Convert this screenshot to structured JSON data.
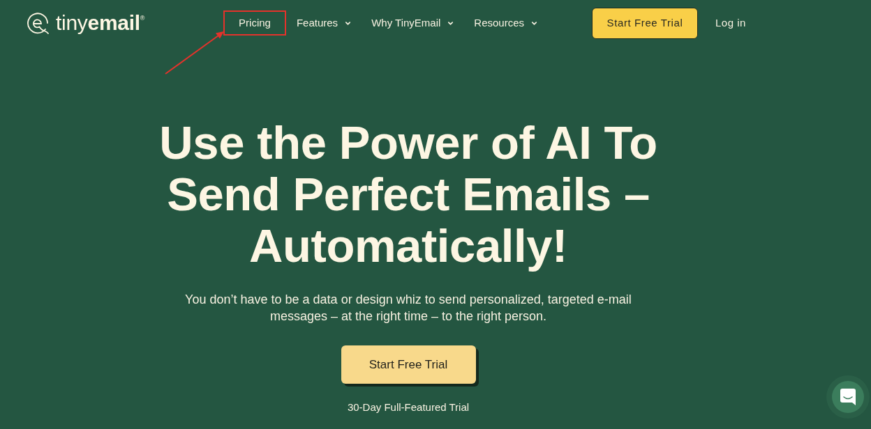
{
  "logo": {
    "wordmark": "tiny**email**$^{®}$"
  },
  "nav": {
    "items": [
      {
        "label": "Pricing",
        "has_dropdown": false,
        "highlighted": true
      },
      {
        "label": "Features",
        "has_dropdown": true,
        "highlighted": false
      },
      {
        "label": "Why TinyEmail",
        "has_dropdown": true,
        "highlighted": false
      },
      {
        "label": "Resources",
        "has_dropdown": true,
        "highlighted": false
      }
    ],
    "cta": "Start Free Trial",
    "login": "Log in"
  },
  "hero": {
    "headline": "Use the Power of AI To Send Perfect Emails – Automatically!",
    "subheadline": "You don’t have to be a data or design whiz to send personalized, targeted e-mail messages – at the right time – to the right person.",
    "cta": "Start Free Trial",
    "note": "30-Day Full-Featured Trial"
  }
}
